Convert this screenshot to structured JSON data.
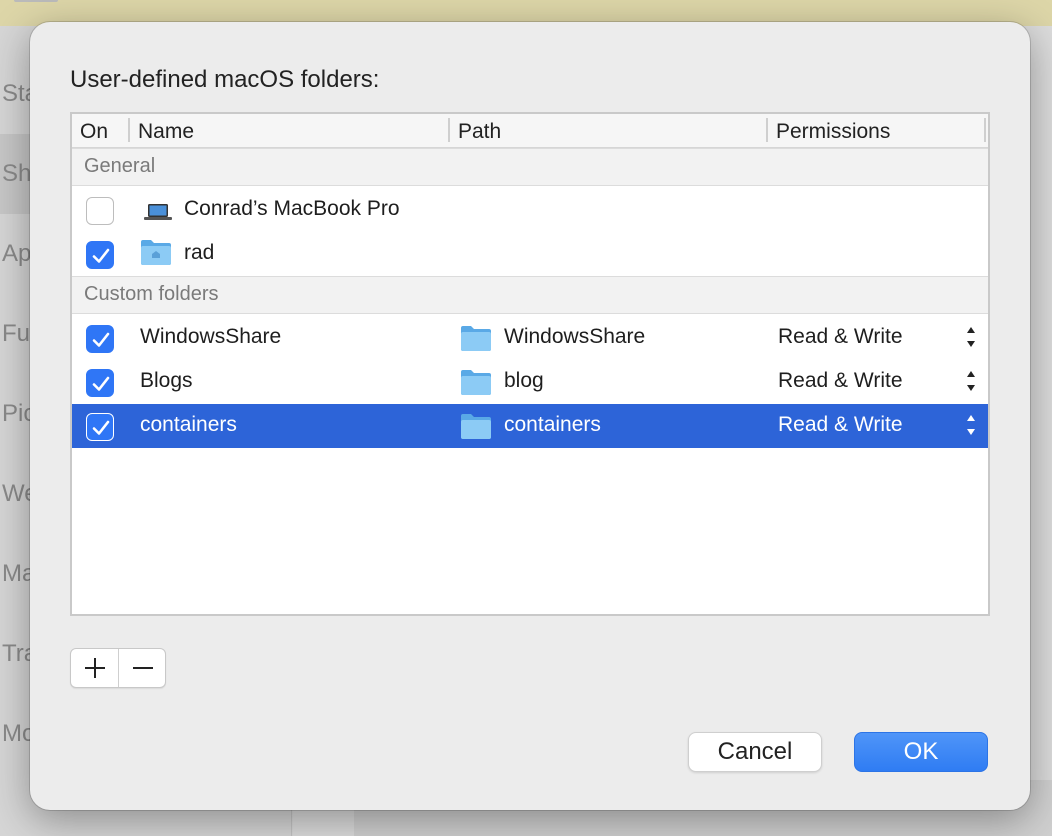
{
  "background": {
    "sidebar_items": [
      "Sta",
      "Sh",
      "Ap",
      "Fu",
      "Pic",
      "We",
      "Ma",
      "Tra",
      "Mo"
    ]
  },
  "dialog": {
    "title": "User-defined macOS folders:",
    "columns": {
      "on": "On",
      "name": "Name",
      "path": "Path",
      "permissions": "Permissions"
    },
    "groups": {
      "general": "General",
      "custom": "Custom folders"
    },
    "general_rows": [
      {
        "checked": false,
        "icon": "laptop-icon",
        "name": "Conrad’s MacBook Pro"
      },
      {
        "checked": true,
        "icon": "home-folder-icon",
        "name": "rad"
      }
    ],
    "custom_rows": [
      {
        "checked": true,
        "name": "WindowsShare",
        "path": "WindowsShare",
        "permission": "Read & Write",
        "selected": false
      },
      {
        "checked": true,
        "name": "Blogs",
        "path": "blog",
        "permission": "Read & Write",
        "selected": false
      },
      {
        "checked": true,
        "name": "containers",
        "path": "containers",
        "permission": "Read & Write",
        "selected": true
      }
    ],
    "buttons": {
      "add": "+",
      "remove": "−",
      "cancel": "Cancel",
      "ok": "OK"
    },
    "colors": {
      "accent": "#2f76f6",
      "selection": "#2d64d8",
      "folder": "#6bb6ef"
    }
  }
}
